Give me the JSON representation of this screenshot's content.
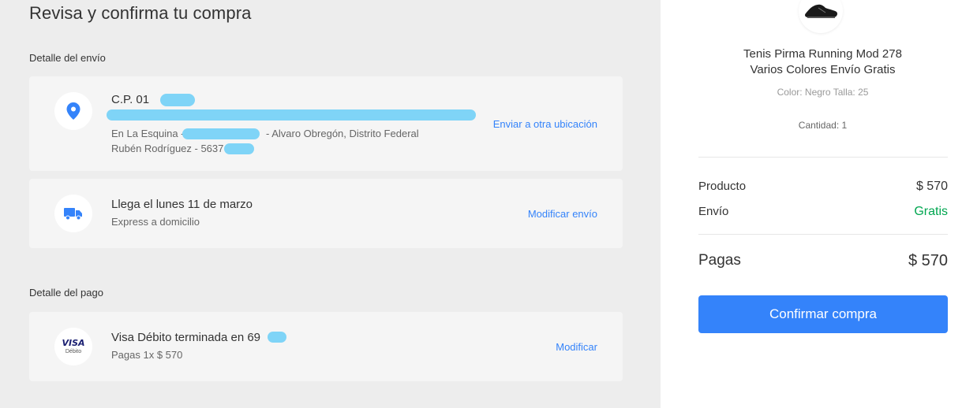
{
  "page": {
    "title": "Revisa y confirma tu compra"
  },
  "shipping": {
    "section_label": "Detalle del envío",
    "address": {
      "postal_code": "C.P. 01",
      "line_1": "En La Esquina -",
      "line_1_suffix": "- Alvaro Obregón, Distrito Federal",
      "contact": "Rubén Rodríguez - 5637",
      "link": "Enviar a otra ubicación",
      "icon": "location-pin-icon"
    },
    "delivery": {
      "title": "Llega el lunes 11 de marzo",
      "subtitle": "Express a domicilio",
      "link": "Modificar envío",
      "icon": "truck-icon"
    }
  },
  "payment": {
    "section_label": "Detalle del pago",
    "method": "Visa Débito terminada en 69",
    "installments": "Pagas 1x $ 570",
    "link": "Modificar",
    "brand_logo_text": "VISA",
    "brand_logo_subtext": "Débito"
  },
  "summary": {
    "product_title_line_1": "Tenis Pirma Running Mod 278",
    "product_title_line_2": "Varios Colores Envío Gratis",
    "variant": "Color: Negro Talla: 25",
    "quantity": "Cantidad: 1",
    "product_label": "Producto",
    "product_price": "$ 570",
    "shipping_label": "Envío",
    "shipping_price": "Gratis",
    "total_label": "Pagas",
    "total_price": "$ 570",
    "confirm_button": "Confirmar compra"
  },
  "colors": {
    "accent": "#3483fa",
    "success": "#00a650",
    "left_background": "#ededed",
    "card_background": "#f5f5f5",
    "redaction": "#7fd4f7"
  }
}
